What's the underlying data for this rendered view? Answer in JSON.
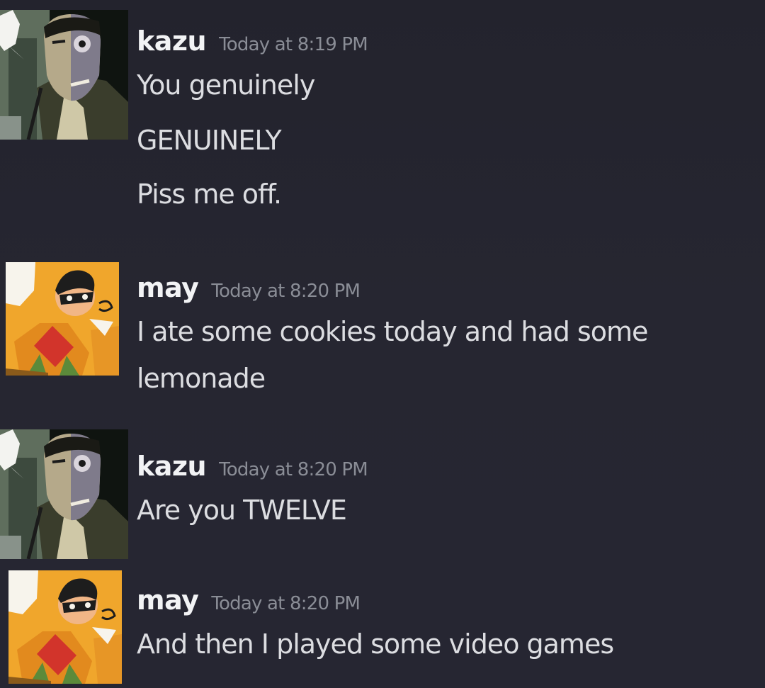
{
  "messages": [
    {
      "author": "kazu",
      "timestamp": "Today at 8:19 PM",
      "avatar_icon": "comic-two-face-avatar",
      "lines": [
        "You genuinely",
        "GENUINELY",
        "Piss me off."
      ]
    },
    {
      "author": "may",
      "timestamp": "Today at 8:20 PM",
      "avatar_icon": "comic-robin-avatar",
      "lines": [
        "I ate some cookies today and had some",
        "lemonade"
      ]
    },
    {
      "author": "kazu",
      "timestamp": "Today at 8:20 PM",
      "avatar_icon": "comic-two-face-avatar",
      "lines": [
        "Are you TWELVE"
      ]
    },
    {
      "author": "may",
      "timestamp": "Today at 8:20 PM",
      "avatar_icon": "comic-robin-avatar",
      "lines": [
        "And then I played some video games"
      ]
    }
  ],
  "colors": {
    "background": "#24242e",
    "username": "#f2f3f5",
    "timestamp": "#8a8d96",
    "message_text": "#dcdde1"
  }
}
